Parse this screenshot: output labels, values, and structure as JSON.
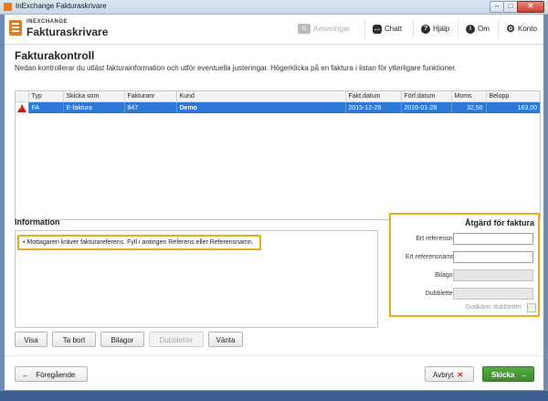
{
  "window": {
    "title": "InExchange Fakturaskrivare",
    "min": "–",
    "max": "□",
    "close": "✕"
  },
  "header": {
    "brand_small": "INEXCHANGE",
    "brand_big": "Fakturaskrivare",
    "notifications_count": "0",
    "notifications_label": "Aviseringar",
    "chat_label": "Chatt",
    "help_label": "Hjälp",
    "about_label": "Om",
    "account_label": "Konto"
  },
  "page": {
    "title": "Fakturakontroll",
    "description": "Nedan kontrollerar du utläst fakturainformation och utför eventuella justeringar. Högerklicka på en faktura i listan för ytterligare funktioner."
  },
  "invoice_table": {
    "columns": [
      "Typ",
      "Skicka som",
      "Fakturanr",
      "Kund",
      "Fakt.datum",
      "Förf.datum",
      "Moms",
      "Belopp"
    ],
    "rows": [
      {
        "typ": "FA",
        "skicka_som": "E-faktura",
        "fakturanr": "847",
        "kund": "Demo",
        "fakt_datum": "2015-12-29",
        "forf_datum": "2016-01-28",
        "moms": "32,50",
        "belopp": "163,00"
      }
    ]
  },
  "information": {
    "title": "Information",
    "messages": [
      "• Mottagaren kräver fakturareferens. Fyll i antingen Referens eller Referensnamn."
    ]
  },
  "action_panel": {
    "title": "Åtgärd för faktura",
    "fields": [
      {
        "label": "Ert referensnr",
        "value": ""
      },
      {
        "label": "Ert referensnamn",
        "value": ""
      },
      {
        "label": "Bilagor",
        "value": ""
      },
      {
        "label": "Dubbletter",
        "value": ""
      }
    ],
    "approve_duplicates_label": "Godkänn dubbletter"
  },
  "toolbar": {
    "visa": "Visa",
    "tabort": "Ta bort",
    "bilagor": "Bilagor",
    "dubbletter": "Dubbletter",
    "vanta": "Vänta"
  },
  "navigation": {
    "previous": "Föregående",
    "previous_arrow": "←",
    "cancel": "Avbryt",
    "cancel_icon": "✕",
    "send": "Skicka",
    "send_arrow": "→"
  }
}
